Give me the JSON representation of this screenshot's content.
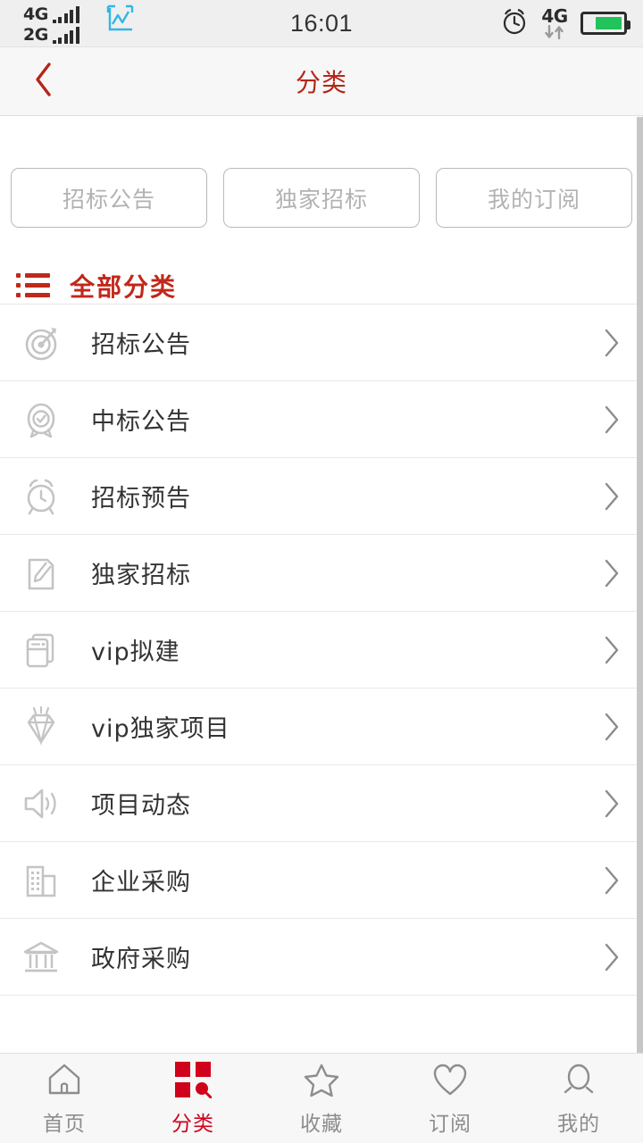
{
  "status_bar": {
    "sim1_network": "4G",
    "sim2_network": "2G",
    "time": "16:01",
    "data_network": "4G",
    "icons": [
      "signal-bars-icon",
      "stock-chart-icon",
      "alarm-clock-icon",
      "data-transfer-icon",
      "battery-icon"
    ]
  },
  "header": {
    "back_icon": "chevron-left-icon",
    "title": "分类",
    "title_color": "#b32619"
  },
  "filters": {
    "buttons": [
      {
        "label": "招标公告"
      },
      {
        "label": "独家招标"
      },
      {
        "label": "我的订阅"
      }
    ]
  },
  "section": {
    "icon": "list-lines-icon",
    "title": "全部分类",
    "accent_color": "#c0281b"
  },
  "categories": [
    {
      "label": "招标公告",
      "icon": "target-icon"
    },
    {
      "label": "中标公告",
      "icon": "check-circle-icon"
    },
    {
      "label": "招标预告",
      "icon": "alarm-clock-icon"
    },
    {
      "label": "独家招标",
      "icon": "edit-pencil-icon"
    },
    {
      "label": "vip拟建",
      "icon": "card-stack-icon"
    },
    {
      "label": "vip独家项目",
      "icon": "diamond-icon"
    },
    {
      "label": "项目动态",
      "icon": "speaker-icon"
    },
    {
      "label": "企业采购",
      "icon": "office-building-icon"
    },
    {
      "label": "政府采购",
      "icon": "bank-building-icon"
    }
  ],
  "chevron_icon": "chevron-right-icon",
  "tabbar": {
    "active_index": 1,
    "active_color": "#d0021b",
    "inactive_color": "#8d8d8d",
    "items": [
      {
        "label": "首页",
        "icon": "home-icon"
      },
      {
        "label": "分类",
        "icon": "grid-search-icon"
      },
      {
        "label": "收藏",
        "icon": "star-icon"
      },
      {
        "label": "订阅",
        "icon": "heart-icon"
      },
      {
        "label": "我的",
        "icon": "person-icon"
      }
    ]
  }
}
